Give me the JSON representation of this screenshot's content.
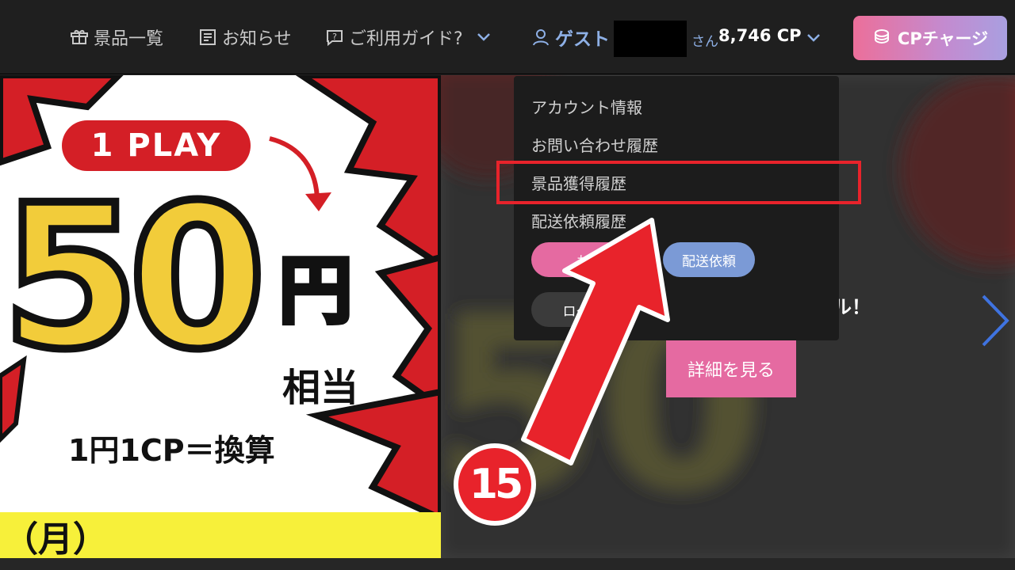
{
  "header": {
    "nav": [
      {
        "label": "景品一覧",
        "icon": "prize-icon"
      },
      {
        "label": "お知らせ",
        "icon": "news-icon"
      },
      {
        "label": "ご利用ガイド?",
        "icon": "guide-icon"
      }
    ],
    "user": {
      "name": "ゲスト",
      "suffix": "さん",
      "points": "8,746 CP"
    },
    "charge_label": "CPチャージ",
    "accent_color": "#8eb0e6"
  },
  "dropdown": {
    "items": [
      "アカウント情報",
      "お問い合わせ履歴",
      "景品獲得履歴",
      "配送依頼履歴"
    ],
    "highlighted_index": 2,
    "pills": {
      "pink": "お",
      "blue": "配送依頼",
      "gray": "ログア"
    }
  },
  "banner_left": {
    "pill": "1 PLAY",
    "big_number": "50",
    "yen": "円",
    "equiv": "相当",
    "conversion": "1円1CP＝換算",
    "day": "（月）"
  },
  "banner_right": {
    "tagline": "ル！",
    "detail_button": "詳細を見る"
  },
  "annotation": {
    "step_number": "15",
    "color": "#e8232b"
  }
}
